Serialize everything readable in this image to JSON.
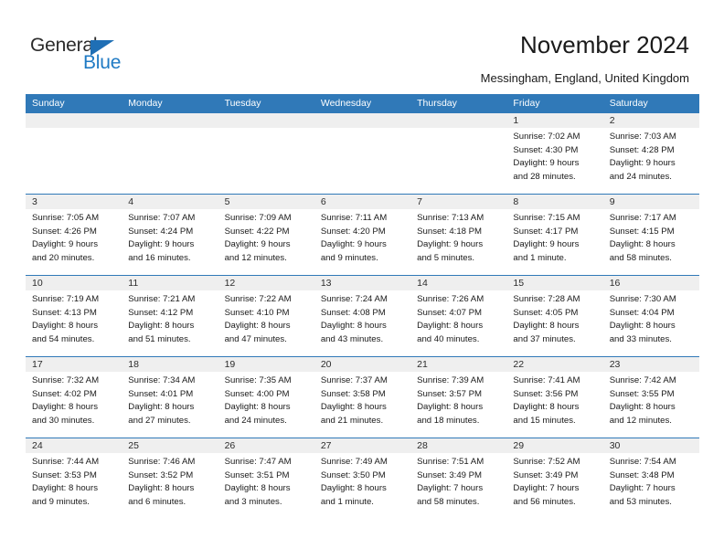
{
  "logo": {
    "word_primary": "General",
    "word_secondary": "Blue",
    "primary_color": "#2b2b2b",
    "secondary_color": "#1f7ac4",
    "triangle_color": "#1f6fb5"
  },
  "header": {
    "title": "November 2024",
    "subtitle": "Messingham, England, United Kingdom"
  },
  "theme": {
    "header_bar_color": "#3079b8",
    "day_band_color": "#efefef",
    "row_border_color": "#3079b8"
  },
  "calendar": {
    "weekdays": [
      "Sunday",
      "Monday",
      "Tuesday",
      "Wednesday",
      "Thursday",
      "Friday",
      "Saturday"
    ],
    "weeks": [
      [
        {
          "day": "",
          "lines": []
        },
        {
          "day": "",
          "lines": []
        },
        {
          "day": "",
          "lines": []
        },
        {
          "day": "",
          "lines": []
        },
        {
          "day": "",
          "lines": []
        },
        {
          "day": "1",
          "lines": [
            "Sunrise: 7:02 AM",
            "Sunset: 4:30 PM",
            "Daylight: 9 hours",
            "and 28 minutes."
          ]
        },
        {
          "day": "2",
          "lines": [
            "Sunrise: 7:03 AM",
            "Sunset: 4:28 PM",
            "Daylight: 9 hours",
            "and 24 minutes."
          ]
        }
      ],
      [
        {
          "day": "3",
          "lines": [
            "Sunrise: 7:05 AM",
            "Sunset: 4:26 PM",
            "Daylight: 9 hours",
            "and 20 minutes."
          ]
        },
        {
          "day": "4",
          "lines": [
            "Sunrise: 7:07 AM",
            "Sunset: 4:24 PM",
            "Daylight: 9 hours",
            "and 16 minutes."
          ]
        },
        {
          "day": "5",
          "lines": [
            "Sunrise: 7:09 AM",
            "Sunset: 4:22 PM",
            "Daylight: 9 hours",
            "and 12 minutes."
          ]
        },
        {
          "day": "6",
          "lines": [
            "Sunrise: 7:11 AM",
            "Sunset: 4:20 PM",
            "Daylight: 9 hours",
            "and 9 minutes."
          ]
        },
        {
          "day": "7",
          "lines": [
            "Sunrise: 7:13 AM",
            "Sunset: 4:18 PM",
            "Daylight: 9 hours",
            "and 5 minutes."
          ]
        },
        {
          "day": "8",
          "lines": [
            "Sunrise: 7:15 AM",
            "Sunset: 4:17 PM",
            "Daylight: 9 hours",
            "and 1 minute."
          ]
        },
        {
          "day": "9",
          "lines": [
            "Sunrise: 7:17 AM",
            "Sunset: 4:15 PM",
            "Daylight: 8 hours",
            "and 58 minutes."
          ]
        }
      ],
      [
        {
          "day": "10",
          "lines": [
            "Sunrise: 7:19 AM",
            "Sunset: 4:13 PM",
            "Daylight: 8 hours",
            "and 54 minutes."
          ]
        },
        {
          "day": "11",
          "lines": [
            "Sunrise: 7:21 AM",
            "Sunset: 4:12 PM",
            "Daylight: 8 hours",
            "and 51 minutes."
          ]
        },
        {
          "day": "12",
          "lines": [
            "Sunrise: 7:22 AM",
            "Sunset: 4:10 PM",
            "Daylight: 8 hours",
            "and 47 minutes."
          ]
        },
        {
          "day": "13",
          "lines": [
            "Sunrise: 7:24 AM",
            "Sunset: 4:08 PM",
            "Daylight: 8 hours",
            "and 43 minutes."
          ]
        },
        {
          "day": "14",
          "lines": [
            "Sunrise: 7:26 AM",
            "Sunset: 4:07 PM",
            "Daylight: 8 hours",
            "and 40 minutes."
          ]
        },
        {
          "day": "15",
          "lines": [
            "Sunrise: 7:28 AM",
            "Sunset: 4:05 PM",
            "Daylight: 8 hours",
            "and 37 minutes."
          ]
        },
        {
          "day": "16",
          "lines": [
            "Sunrise: 7:30 AM",
            "Sunset: 4:04 PM",
            "Daylight: 8 hours",
            "and 33 minutes."
          ]
        }
      ],
      [
        {
          "day": "17",
          "lines": [
            "Sunrise: 7:32 AM",
            "Sunset: 4:02 PM",
            "Daylight: 8 hours",
            "and 30 minutes."
          ]
        },
        {
          "day": "18",
          "lines": [
            "Sunrise: 7:34 AM",
            "Sunset: 4:01 PM",
            "Daylight: 8 hours",
            "and 27 minutes."
          ]
        },
        {
          "day": "19",
          "lines": [
            "Sunrise: 7:35 AM",
            "Sunset: 4:00 PM",
            "Daylight: 8 hours",
            "and 24 minutes."
          ]
        },
        {
          "day": "20",
          "lines": [
            "Sunrise: 7:37 AM",
            "Sunset: 3:58 PM",
            "Daylight: 8 hours",
            "and 21 minutes."
          ]
        },
        {
          "day": "21",
          "lines": [
            "Sunrise: 7:39 AM",
            "Sunset: 3:57 PM",
            "Daylight: 8 hours",
            "and 18 minutes."
          ]
        },
        {
          "day": "22",
          "lines": [
            "Sunrise: 7:41 AM",
            "Sunset: 3:56 PM",
            "Daylight: 8 hours",
            "and 15 minutes."
          ]
        },
        {
          "day": "23",
          "lines": [
            "Sunrise: 7:42 AM",
            "Sunset: 3:55 PM",
            "Daylight: 8 hours",
            "and 12 minutes."
          ]
        }
      ],
      [
        {
          "day": "24",
          "lines": [
            "Sunrise: 7:44 AM",
            "Sunset: 3:53 PM",
            "Daylight: 8 hours",
            "and 9 minutes."
          ]
        },
        {
          "day": "25",
          "lines": [
            "Sunrise: 7:46 AM",
            "Sunset: 3:52 PM",
            "Daylight: 8 hours",
            "and 6 minutes."
          ]
        },
        {
          "day": "26",
          "lines": [
            "Sunrise: 7:47 AM",
            "Sunset: 3:51 PM",
            "Daylight: 8 hours",
            "and 3 minutes."
          ]
        },
        {
          "day": "27",
          "lines": [
            "Sunrise: 7:49 AM",
            "Sunset: 3:50 PM",
            "Daylight: 8 hours",
            "and 1 minute."
          ]
        },
        {
          "day": "28",
          "lines": [
            "Sunrise: 7:51 AM",
            "Sunset: 3:49 PM",
            "Daylight: 7 hours",
            "and 58 minutes."
          ]
        },
        {
          "day": "29",
          "lines": [
            "Sunrise: 7:52 AM",
            "Sunset: 3:49 PM",
            "Daylight: 7 hours",
            "and 56 minutes."
          ]
        },
        {
          "day": "30",
          "lines": [
            "Sunrise: 7:54 AM",
            "Sunset: 3:48 PM",
            "Daylight: 7 hours",
            "and 53 minutes."
          ]
        }
      ]
    ]
  }
}
